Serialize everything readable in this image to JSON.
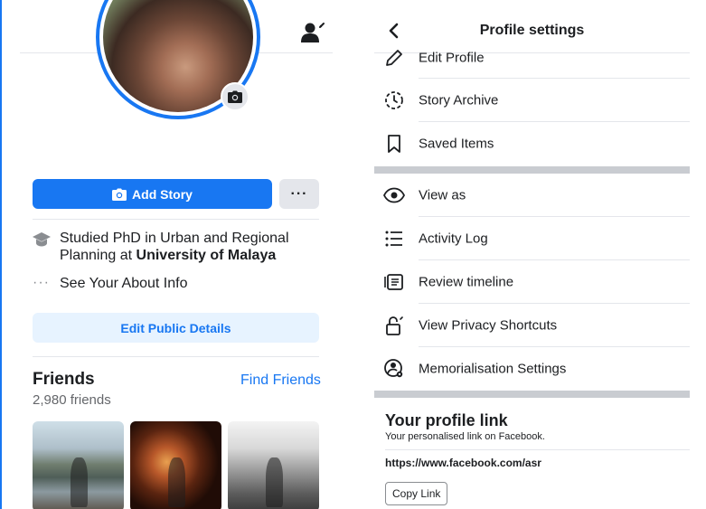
{
  "left_panel": {
    "add_story_label": "Add Story",
    "more_label": "···",
    "education": {
      "prefix": "Studied PhD in Urban and Regional Planning at ",
      "school": "University of Malaya"
    },
    "about_label": "See Your About Info",
    "about_dots": "···",
    "edit_public_label": "Edit Public Details",
    "friends": {
      "title": "Friends",
      "find_label": "Find Friends",
      "count": "2,980 friends"
    }
  },
  "right_panel": {
    "title": "Profile settings",
    "group1": [
      {
        "label": "Edit Profile",
        "icon": "pencil-icon"
      },
      {
        "label": "Story Archive",
        "icon": "story-archive-icon"
      },
      {
        "label": "Saved Items",
        "icon": "bookmark-icon"
      }
    ],
    "group2": [
      {
        "label": "View as",
        "icon": "eye-icon"
      },
      {
        "label": "Activity Log",
        "icon": "list-icon"
      },
      {
        "label": "Review timeline",
        "icon": "review-timeline-icon"
      },
      {
        "label": "View Privacy Shortcuts",
        "icon": "lock-icon"
      },
      {
        "label": "Memorialisation Settings",
        "icon": "memorialisation-icon"
      }
    ],
    "profile_link": {
      "title": "Your profile link",
      "subtitle": "Your personalised link on Facebook.",
      "url": "https://www.facebook.com/asr",
      "copy_label": "Copy Link"
    }
  },
  "colors": {
    "brand": "#1877f2",
    "light_blue": "#e7f3ff",
    "gray_button": "#e4e6eb",
    "text_primary": "#1c1e21",
    "text_secondary": "#65676b"
  }
}
